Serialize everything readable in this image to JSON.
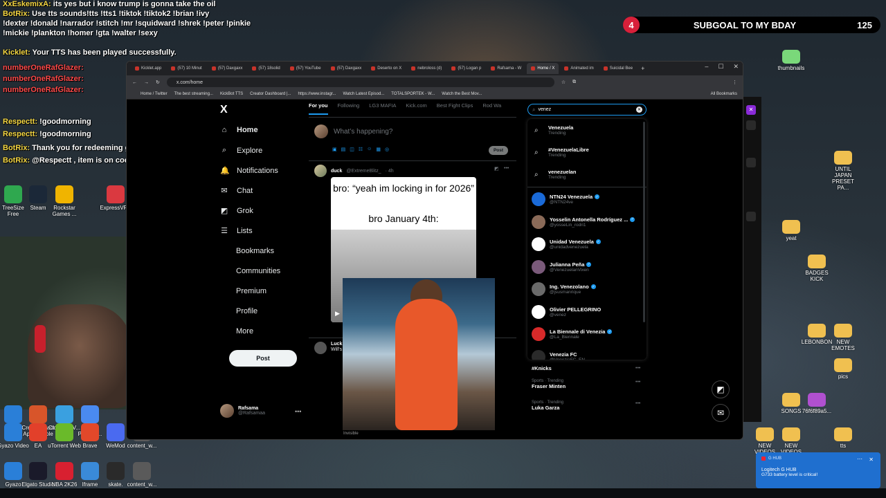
{
  "chat": {
    "lines": [
      {
        "user": "XxEskemixA:",
        "text": " its yes but i know trump is gonna take the oil"
      },
      {
        "user": "BotRix:",
        "text": " Use tts sounds!tts !tts1 !tiktok !tiktok2 !brian !ivy"
      },
      {
        "user": "",
        "text": "!dexter !donald !narrador !stitch !mr !squidward !shrek !peter !pinkie"
      },
      {
        "user": "",
        "text": "!mickie !plankton !homer !gta !walter !sexy"
      },
      {
        "user": "Kicklet:",
        "text": " Your TTS has been played successfully."
      },
      {
        "user": "numberOneRafGlazer:",
        "text": ""
      },
      {
        "user": "numberOneRafGlazer:",
        "text": ""
      },
      {
        "user": "numberOneRafGlazer:",
        "text": ""
      },
      {
        "user": "Respectt:",
        "text": " !goodmorning"
      },
      {
        "user": "Respectt:",
        "text": " !goodmorning"
      },
      {
        "user": "BotRix:",
        "text": " Thank you for redeeming goodmorning @Respectt"
      },
      {
        "user": "BotRix:",
        "text": " @Respectt , item is on cooldown."
      }
    ]
  },
  "subgoal": {
    "badge": "4",
    "label": "SUBGOAL TO MY BDAY",
    "count": "125"
  },
  "desktop_left": [
    {
      "label": "TreeSize Free",
      "color": "#2fa84f"
    },
    {
      "label": "Steam",
      "color": "#1b2838"
    },
    {
      "label": "Rockstar Games ...",
      "color": "#f0b400"
    },
    {
      "label": "ExpressVPN",
      "color": "#da3940"
    },
    {
      "label": "Gyazo",
      "color": "#2a7fd8"
    },
    {
      "label": "Create React App Sample",
      "color": "#d8552a"
    },
    {
      "label": "ClownfishV...",
      "color": "#3aa0e0"
    },
    {
      "label": "Google Passwo...",
      "color": "#4a8af0"
    },
    {
      "label": "Gyazo Video",
      "color": "#2a7fd8"
    },
    {
      "label": "EA",
      "color": "#e2402a"
    },
    {
      "label": "uTorrent Web",
      "color": "#6aba2a"
    },
    {
      "label": "Brave",
      "color": "#e2482a"
    },
    {
      "label": "WeMod",
      "color": "#4a6af0"
    },
    {
      "label": "content_w...",
      "color": "#5a5a5a"
    },
    {
      "label": "Gyazo Replay",
      "color": "#2a7fd8"
    },
    {
      "label": "Elgato Studio",
      "color": "#1a1a2a"
    },
    {
      "label": "NBA 2K26",
      "color": "#d82030"
    },
    {
      "label": "Iframe Control Deck.exe",
      "color": "#3a8ad8"
    },
    {
      "label": "skate.",
      "color": "#2a2a2a"
    },
    {
      "label": "content_w...",
      "color": "#5a5a5a"
    }
  ],
  "desktop_right": [
    {
      "label": "thumbnails",
      "color": "#7ad87a"
    },
    {
      "label": "UNTIL JAPAN PRESET PA...",
      "color": "#f0c050"
    },
    {
      "label": "yeat",
      "color": "#f0c050"
    },
    {
      "label": "BADGES KICK",
      "color": "#f0c050"
    },
    {
      "label": "LEBONBON",
      "color": "#f0c050"
    },
    {
      "label": "NEW EMOTES",
      "color": "#f0c050"
    },
    {
      "label": "pics",
      "color": "#f0c050"
    },
    {
      "label": "SONGS",
      "color": "#f0c050"
    },
    {
      "label": "76f6f89a5...",
      "color": "#b050d0"
    },
    {
      "label": "NEW VIDEOS",
      "color": "#f0c050"
    },
    {
      "label": "NEW VIDEOS",
      "color": "#f0c050"
    },
    {
      "label": "tts",
      "color": "#f0c050"
    }
  ],
  "browser": {
    "tabs": [
      "Kicklet.app",
      "(57) 10 Minut",
      "(57) Daxgaxx",
      "(57) 18solid",
      "(57) YouTube",
      "(57) Daxgaxx",
      "Deserto on X",
      "nebroloss (d)",
      "(57) Logan p",
      "Rafsama - W",
      "Home / X",
      "Animated im",
      "Suicidal Bee"
    ],
    "active_tab": 10,
    "url": "x.com/home",
    "bookmarks": [
      "Home / Twitter",
      "The best streaming...",
      "KickBot TTS",
      "Creator Dashboard |...",
      "https://www.instagr...",
      "Watch Latest Episod...",
      "TOTALSPORTEK - W...",
      "Watch the Best Mov..."
    ],
    "all_bookmarks": "All Bookmarks"
  },
  "x": {
    "logo": "X",
    "nav": [
      {
        "label": "Home",
        "icon": "⌂",
        "icon_name": "home-icon",
        "active": true
      },
      {
        "label": "Explore",
        "icon": "⌕",
        "icon_name": "explore-icon"
      },
      {
        "label": "Notifications",
        "icon": "🔔",
        "icon_name": "bell-icon"
      },
      {
        "label": "Chat",
        "icon": "✉",
        "icon_name": "chat-icon"
      },
      {
        "label": "Grok",
        "icon": "◩",
        "icon_name": "grok-icon"
      },
      {
        "label": "Lists",
        "icon": "☰",
        "icon_name": "lists-icon"
      }
    ],
    "nav_plain": [
      "Bookmarks",
      "Communities",
      "Premium",
      "Profile",
      "More"
    ],
    "post_button": "Post",
    "profile": {
      "name": "Rafsama",
      "handle": "@Rafsamaa"
    },
    "topics": [
      "For you",
      "Following",
      "LG3 MAFIA",
      "Kick.com",
      "Best Fight Clips",
      "Rod Wa"
    ],
    "compose_placeholder": "What’s happening?",
    "compose_post": "Post",
    "tweet1": {
      "name": "duck",
      "handle": "@ExtremeBlitz_",
      "time": "· 4h",
      "meme_line1": "bro: “yeah im locking in for 2026”",
      "meme_line2": "bro January 4th:"
    },
    "tweet2": {
      "name": "Luck",
      "body": "Will's remo"
    },
    "invisible": "Invisible",
    "search": {
      "value": "venez",
      "placeholder": "Search"
    },
    "suggestions": [
      {
        "title": "Venezuela",
        "sub": "Trending"
      },
      {
        "title": "#VenezuelaLibre",
        "sub": "Trending"
      },
      {
        "title": "venezuelan",
        "sub": "Trending"
      }
    ],
    "accounts": [
      {
        "name": "NTN24 Venezuela",
        "handle": "@NTN24ve",
        "verified": true,
        "color": "#1a6ad8"
      },
      {
        "name": "Yosselin Antonella Rodríguez ...",
        "handle": "@yosseLin_rodri1",
        "verified": true,
        "color": "#8a6a58"
      },
      {
        "name": "Unidad Venezuela",
        "handle": "@unidadvenezuela",
        "verified": true,
        "color": "#ffffff"
      },
      {
        "name": "Julianna Peña",
        "handle": "@VenezuelanVixen",
        "verified": true,
        "color": "#7a5a7a"
      },
      {
        "name": "Ing. Venezolano",
        "handle": "@jsusmanrique",
        "verified": true,
        "color": "#6a6a6a"
      },
      {
        "name": "Olivier PELLEGRINO",
        "handle": "@venez",
        "verified": false,
        "color": "#ffffff"
      },
      {
        "name": "La Biennale di Venezia",
        "handle": "@La_Biennale",
        "verified": true,
        "color": "#d82a2a"
      },
      {
        "name": "Venezia FC",
        "handle": "@VeneziaFC_EN",
        "verified": false,
        "color": "#2a2a2a"
      }
    ],
    "trends_below": [
      {
        "cat": "",
        "title": "#Knicks"
      },
      {
        "cat": "Sports · Trending",
        "title": "Fraser Minten"
      },
      {
        "cat": "Sports · Trending",
        "title": "Luka Garza"
      }
    ]
  },
  "toast": {
    "app": "G HUB",
    "title": "Logitech G HUB",
    "message": "G733 battery level is critical!"
  }
}
